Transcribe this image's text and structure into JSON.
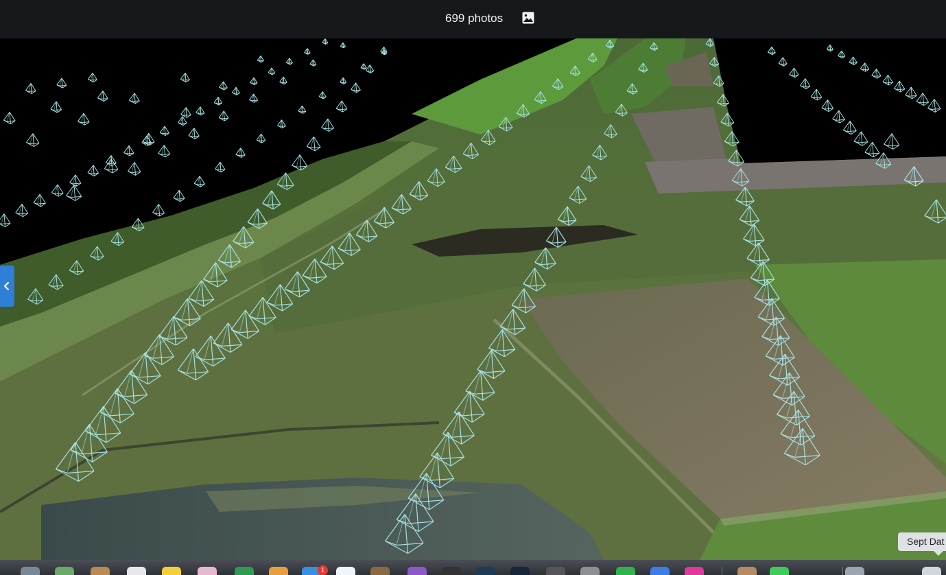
{
  "header": {
    "photo_count_label": "699 photos",
    "photos_icon": "image-icon"
  },
  "viewer": {
    "collapse_icon": "chevron-left-icon",
    "accent_color": "#2f7fd6",
    "camera_frustum_color": "#a9e6e8"
  },
  "layer_label": "Sept Dat",
  "dock": {
    "badge_count": "1",
    "apps": [
      {
        "name": "dock-app-1",
        "color": "#7a8896"
      },
      {
        "name": "dock-app-2",
        "color": "#6aa86b"
      },
      {
        "name": "dock-app-3",
        "color": "#b98a52"
      },
      {
        "name": "dock-app-4",
        "color": "#e8e8e8"
      },
      {
        "name": "dock-app-5",
        "color": "#f3cf3b"
      },
      {
        "name": "dock-app-6",
        "color": "#e7b8d3"
      },
      {
        "name": "dock-app-7",
        "color": "#2f9a52"
      },
      {
        "name": "dock-app-8",
        "color": "#e89f3a"
      },
      {
        "name": "dock-app-9",
        "color": "#3a8fe3"
      },
      {
        "name": "dock-app-10",
        "color": "#f1f4f8"
      },
      {
        "name": "dock-app-11",
        "color": "#8a6a42"
      },
      {
        "name": "dock-app-12",
        "color": "#8e58c9"
      },
      {
        "name": "dock-app-13",
        "color": "#333333"
      },
      {
        "name": "dock-app-14",
        "color": "#1d3b55"
      },
      {
        "name": "dock-app-15",
        "color": "#172638"
      },
      {
        "name": "dock-app-16",
        "color": "#555555"
      },
      {
        "name": "dock-app-17",
        "color": "#909090"
      },
      {
        "name": "dock-app-18",
        "color": "#2fb24f"
      },
      {
        "name": "dock-app-19",
        "color": "#3c7de6"
      },
      {
        "name": "dock-app-20",
        "color": "#e0399a"
      },
      {
        "name": "dock-app-21",
        "color": "#b38c64"
      },
      {
        "name": "dock-app-22",
        "color": "#3fcc5a"
      },
      {
        "name": "dock-app-23",
        "color": "#9aa5ad"
      },
      {
        "name": "dock-app-24",
        "color": "#d0d8de"
      }
    ]
  }
}
